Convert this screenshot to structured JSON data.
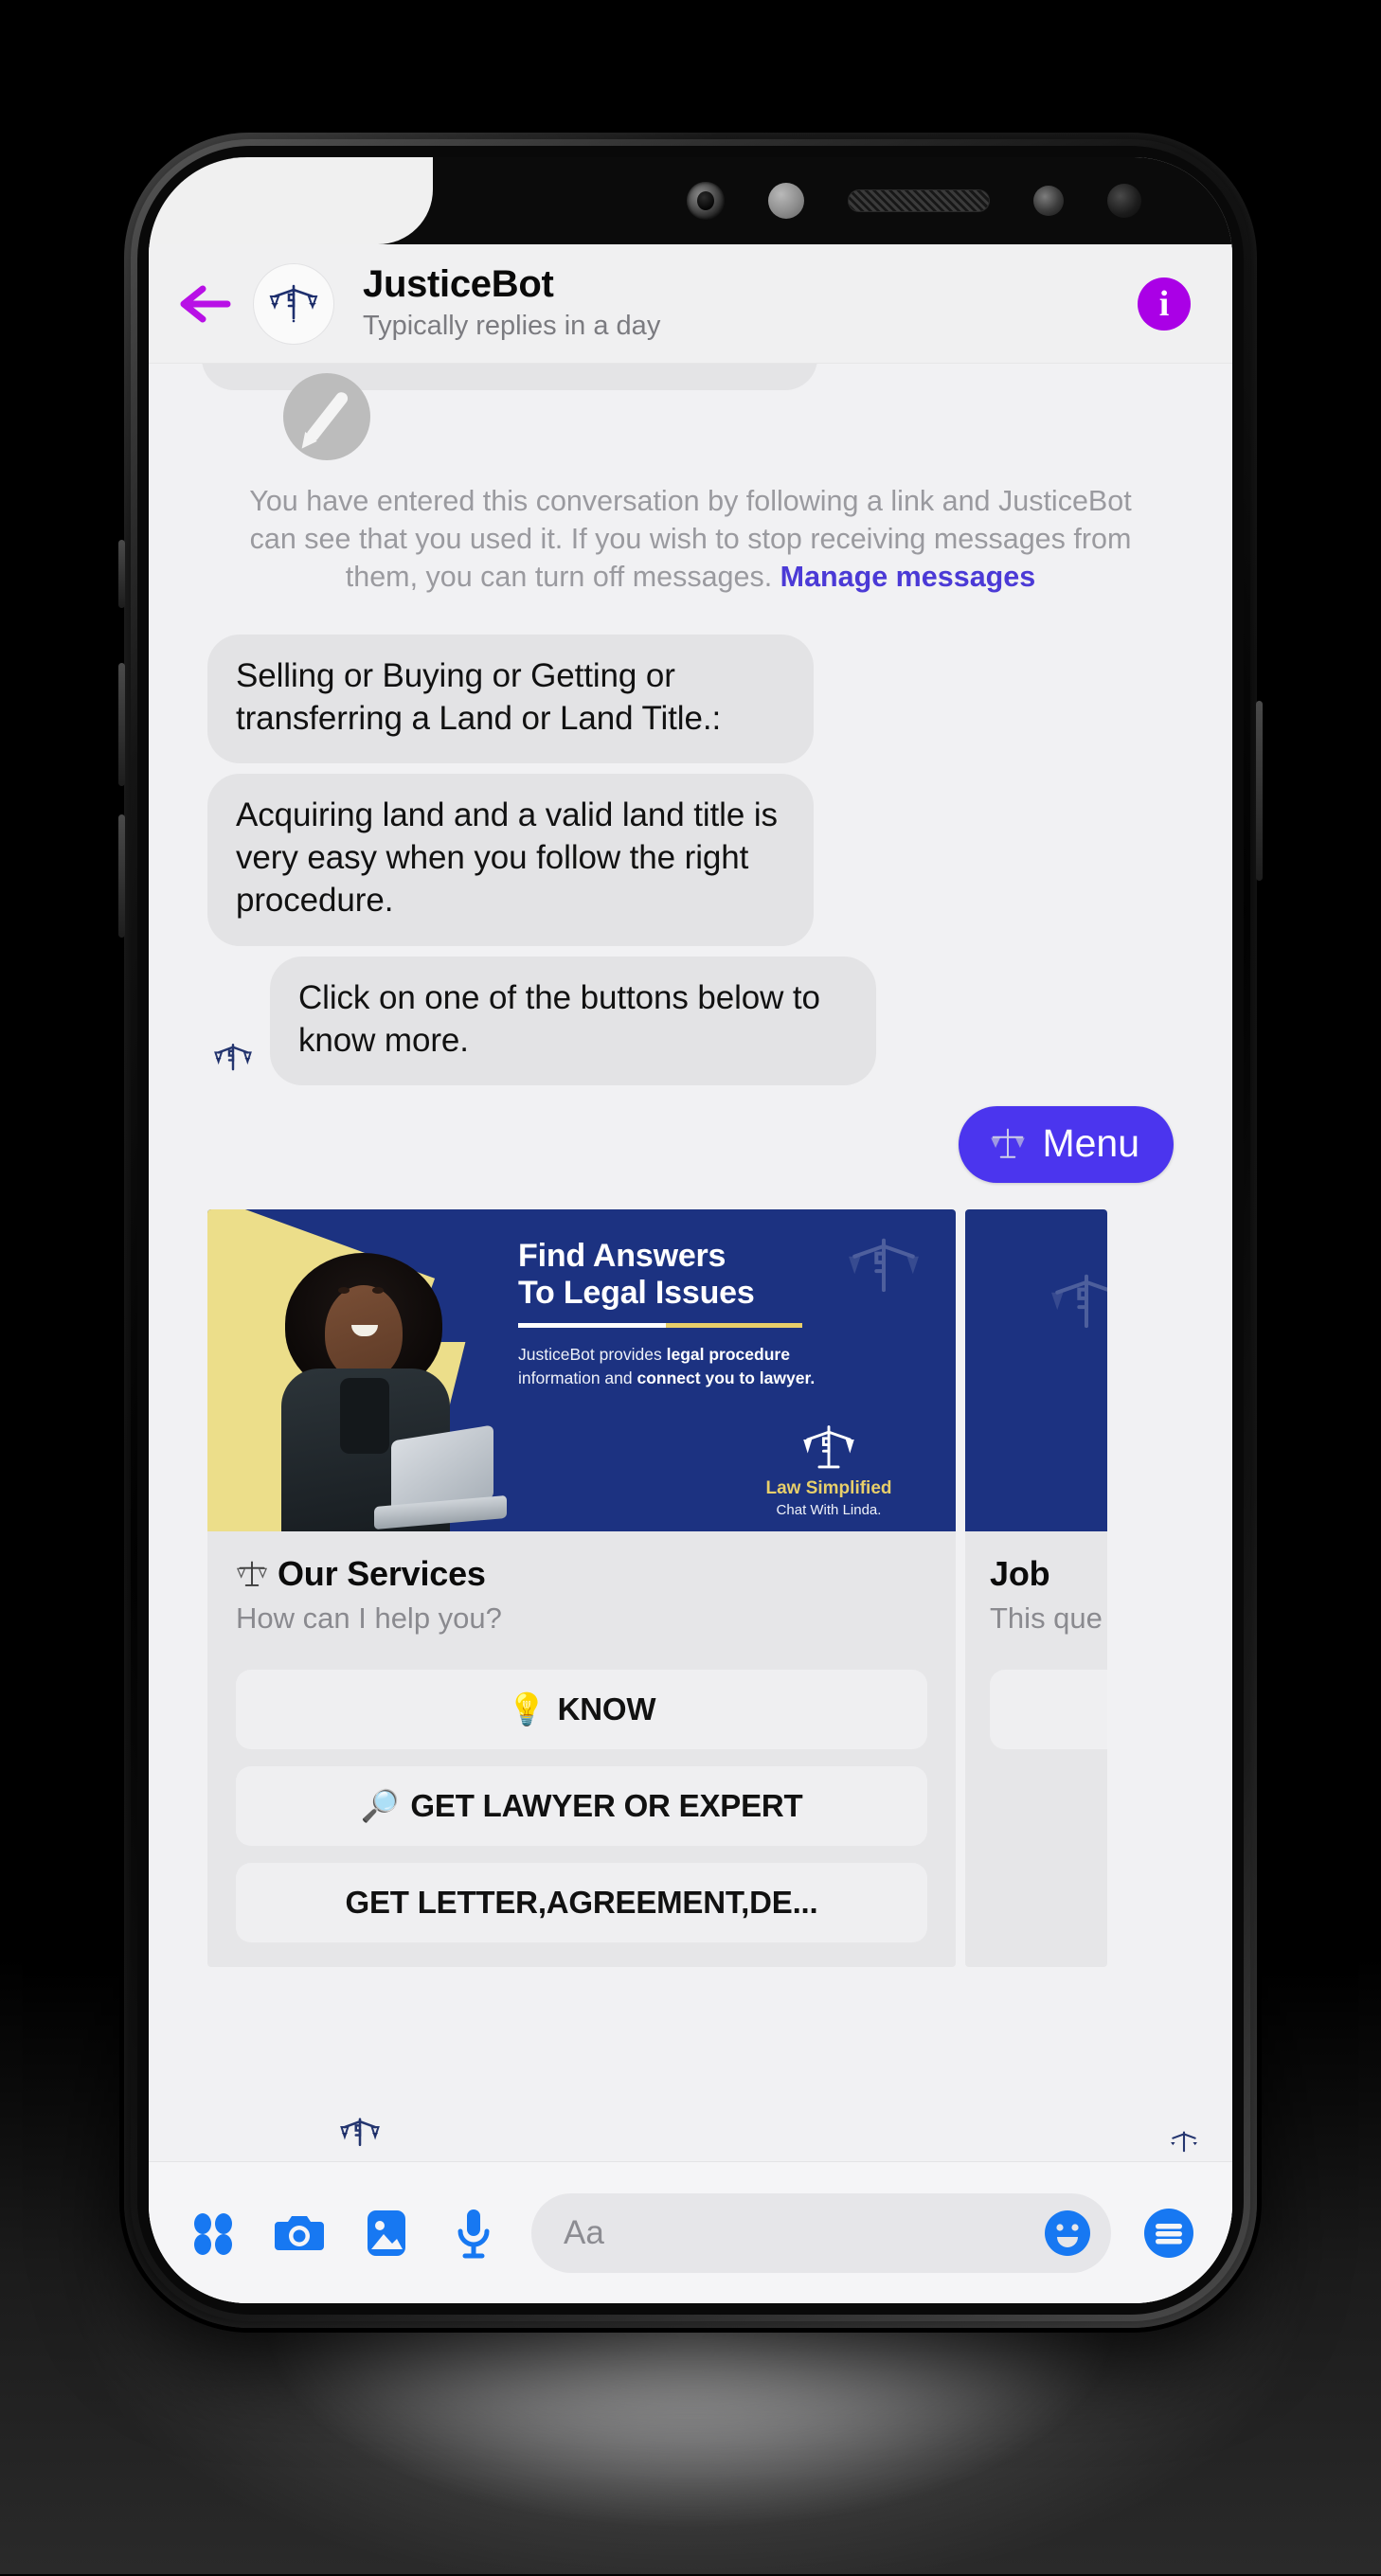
{
  "header": {
    "back_icon": "back-arrow-icon",
    "avatar_icon": "scales-of-justice-icon",
    "name": "JusticeBot",
    "subtitle": "Typically replies in a day",
    "info_icon_label": "i",
    "info_color": "#aa00e6"
  },
  "thread": {
    "disclaimer_text": "You have entered this conversation by following a link and JusticeBot can see that you used it. If you wish to stop receiving messages from them, you can turn off messages. ",
    "disclaimer_link": "Manage messages",
    "link_color": "#4b3ad6",
    "messages": [
      "Selling or Buying or Getting or transferring a Land or Land Title.:",
      "Acquiring land and a valid land title is very easy when you follow the right procedure.",
      "Click on one of the buttons below to know more."
    ],
    "menu_button": {
      "label": "Menu",
      "icon": "scales-of-justice-icon",
      "color": "#4b35ee"
    }
  },
  "carousel": {
    "cards": [
      {
        "hero": {
          "title_line1": "Find Answers",
          "title_line2": "To Legal Issues",
          "body_prefix": "JusticeBot provides ",
          "body_bold1": "legal procedure",
          "body_mid": " information and ",
          "body_bold2": "connect you to lawyer.",
          "brand_label": "Law Simplified",
          "brand_sub": "Chat With Linda.",
          "bg_color": "#1c3281",
          "accent_color": "#ecde8a"
        },
        "title": "Our Services",
        "title_icon": "scales-of-justice-icon",
        "subtitle": "How can I help you?",
        "buttons": [
          {
            "icon": "lightbulb-icon",
            "label": "KNOW"
          },
          {
            "icon": "magnifier-icon",
            "label": "GET LAWYER OR EXPERT"
          },
          {
            "icon": "",
            "label": "GET LETTER,AGREEMENT,DE..."
          }
        ]
      },
      {
        "title": "Job",
        "subtitle": "This que",
        "buttons": [
          {
            "icon": "",
            "label": ""
          }
        ]
      }
    ]
  },
  "composer": {
    "icons": [
      "four-dots-icon",
      "camera-icon",
      "gallery-icon",
      "microphone-icon"
    ],
    "input_placeholder": "Aa",
    "emoji_icon": "smiley-icon",
    "sticker_icon": "hamburger-circle-icon",
    "accent_color": "#1778f2"
  }
}
